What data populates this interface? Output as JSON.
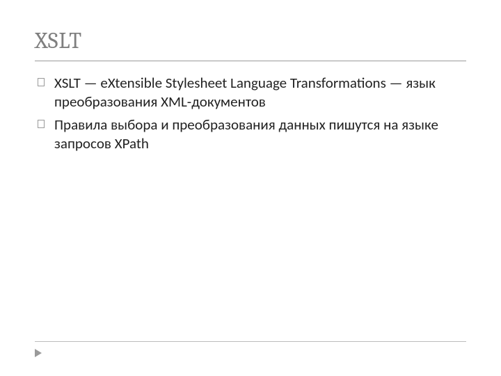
{
  "slide": {
    "title": "XSLT",
    "bullets": [
      "XSLT  — eXtensible Stylesheet Language Transformations — язык преобразования XML-документов",
      "Правила выбора и преобразования данных пишутся на языке запросов XPath"
    ]
  }
}
